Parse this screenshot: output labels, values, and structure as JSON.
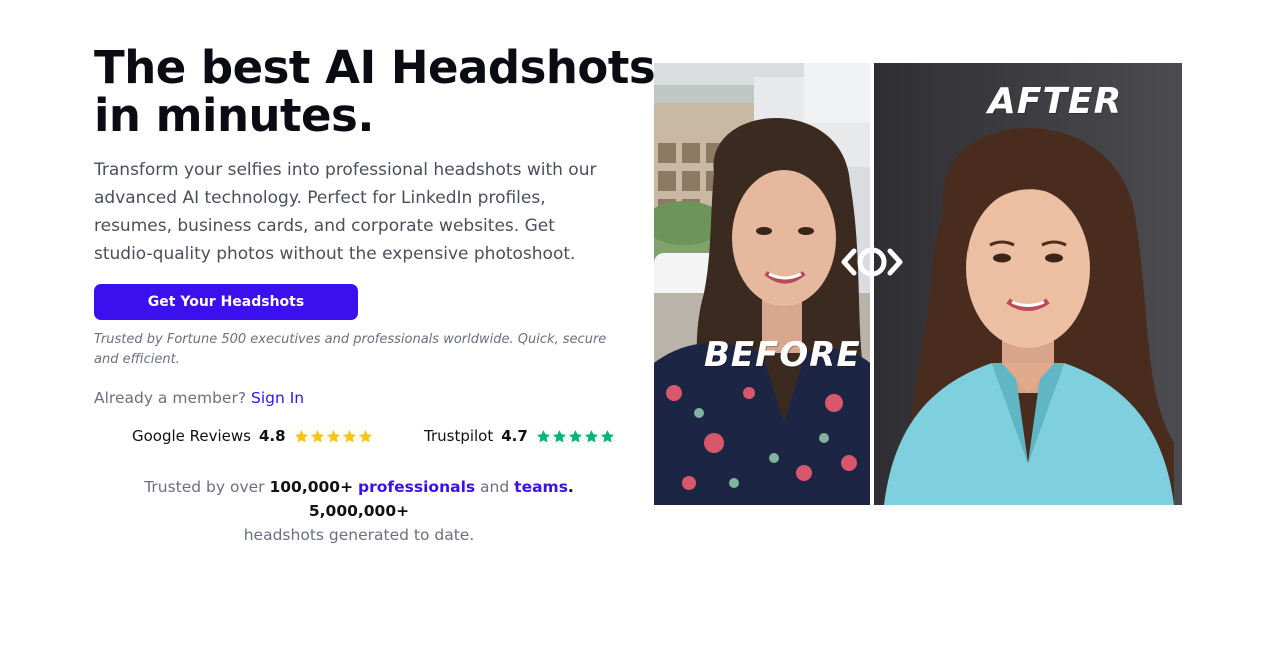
{
  "hero": {
    "title_line1": "The best AI Headshots",
    "title_line2": "in minutes.",
    "description": "Transform your selfies into professional headshots with our advanced AI technology. Perfect for LinkedIn profiles, resumes, business cards, and corporate websites. Get studio-quality photos without the expensive photoshoot.",
    "cta_label": "Get Your Headshots",
    "trusted_note": "Trusted by Fortune 500 executives and professionals worldwide. Quick, secure and efficient."
  },
  "member": {
    "prompt": "Already a member?",
    "sign_in_label": "Sign In"
  },
  "reviews": [
    {
      "name": "Google Reviews",
      "score": "4.8",
      "stars": 5,
      "star_color": "#f5c518"
    },
    {
      "name": "Trustpilot",
      "score": "4.7",
      "stars": 5,
      "star_color": "#00b67a"
    }
  ],
  "summary": {
    "prefix": "Trusted by over",
    "count_users": "100,000+",
    "professionals": "professionals",
    "and": "and",
    "teams": "teams",
    "count_headshots": "5,000,000+",
    "suffix": "headshots generated to date."
  },
  "comparison": {
    "before_label": "BEFORE",
    "after_label": "AFTER"
  },
  "colors": {
    "accent": "#3b10ef",
    "heading": "#0b0b14",
    "body_text": "#4a4f5c",
    "muted": "#6b7080",
    "after_blouse": "#7fd0de"
  }
}
